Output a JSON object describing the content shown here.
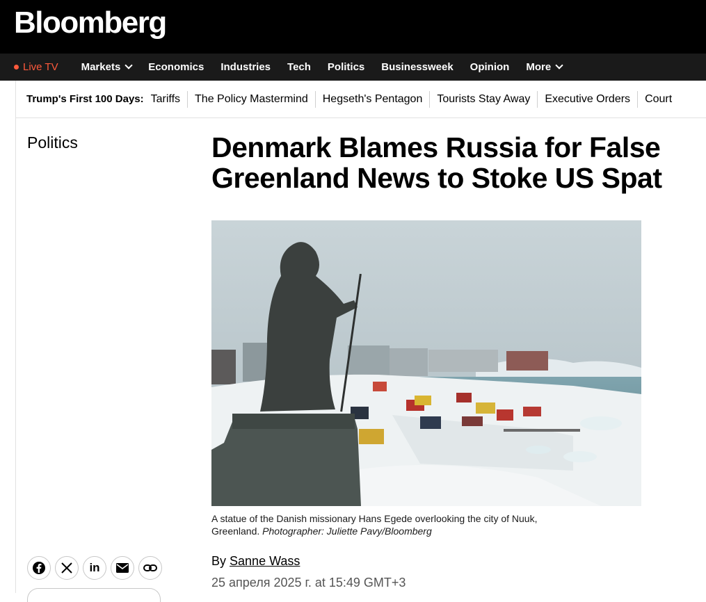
{
  "brand": {
    "logo": "Bloomberg"
  },
  "nav": {
    "live_label": "Live TV",
    "items": [
      "Markets",
      "Economics",
      "Industries",
      "Tech",
      "Politics",
      "Businessweek",
      "Opinion",
      "More"
    ],
    "live_color": "#ff5a3c"
  },
  "trending": {
    "title": "Trump's First 100 Days:",
    "links": [
      "Tariffs",
      "The Policy Mastermind",
      "Hegseth's Pentagon",
      "Tourists Stay Away",
      "Executive Orders",
      "Court"
    ]
  },
  "article": {
    "section": "Politics",
    "headline_line1": "Denmark Blames Russia for False",
    "headline_line2": "Greenland News to Stoke US Spat",
    "caption_text": "A statue of the Danish missionary Hans Egede overlooking the city of Nuuk, Greenland.",
    "caption_credit": "Photographer: Juliette Pavy/Bloomberg",
    "byline_prefix": "By",
    "author": "Sanne Wass",
    "date": "25 апреля 2025 г. at 15:49 GMT+3"
  },
  "share": {
    "icons": [
      "facebook-icon",
      "x-icon",
      "linkedin-icon",
      "email-icon",
      "link-icon"
    ]
  }
}
